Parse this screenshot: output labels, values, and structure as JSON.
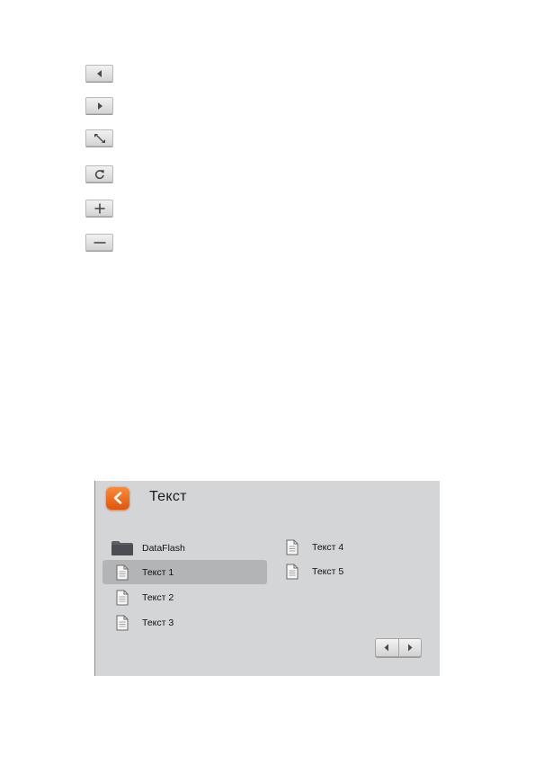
{
  "screen": {
    "title": "Текст",
    "items_left": [
      {
        "label": "DataFlash",
        "icon": "folder-icon",
        "selected": false
      },
      {
        "label": "Текст 1",
        "icon": "document-icon",
        "selected": true
      },
      {
        "label": "Текст 2",
        "icon": "document-icon",
        "selected": false
      },
      {
        "label": "Текст 3",
        "icon": "document-icon",
        "selected": false
      }
    ],
    "items_right": [
      {
        "label": "Текст 4",
        "icon": "document-icon",
        "selected": false
      },
      {
        "label": "Текст 5",
        "icon": "document-icon",
        "selected": false
      }
    ]
  },
  "icon_buttons": [
    {
      "icon": "arrow-left-icon"
    },
    {
      "icon": "arrow-right-icon"
    },
    {
      "icon": "expand-icon"
    },
    {
      "icon": "refresh-icon"
    },
    {
      "icon": "plus-icon"
    },
    {
      "icon": "minus-icon"
    }
  ],
  "colors": {
    "accent": "#f26a1b",
    "screen_bg": "#d4d5d6",
    "selected_bg": "#b3b4b5"
  }
}
